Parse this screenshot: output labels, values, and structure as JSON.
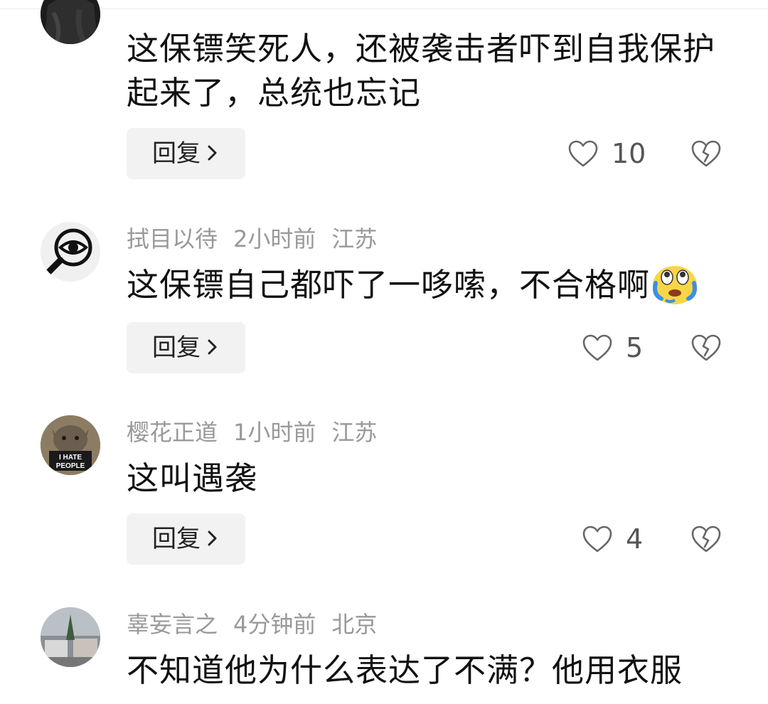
{
  "comments": [
    {
      "username": "",
      "time": "",
      "location": "",
      "text": "这保镖笑死人，还被袭击者吓到自我保护起来了，总统也忘记",
      "reply_label": "回复",
      "likes": "10"
    },
    {
      "username": "拭目以待",
      "time": "2小时前",
      "location": "江苏",
      "text": "这保镖自己都吓了一哆嗦，不合格啊",
      "reply_label": "回复",
      "likes": "5"
    },
    {
      "username": "樱花正道",
      "time": "1小时前",
      "location": "江苏",
      "text": "这叫遇袭",
      "avatar_text": "I HATE PEOPLE",
      "reply_label": "回复",
      "likes": "4"
    },
    {
      "username": "辜妄言之",
      "time": "4分钟前",
      "location": "北京",
      "text": "不知道他为什么表达了不满？他用衣服"
    }
  ],
  "icons": {
    "like": "heart-outline-icon",
    "dislike": "broken-heart-icon",
    "reply_chevron": "chevron-right-icon",
    "emoji": "crying-emoji-icon"
  },
  "colors": {
    "meta": "#999999",
    "text": "#111111",
    "reply_bg": "#f2f2f2",
    "icon": "#666666"
  }
}
